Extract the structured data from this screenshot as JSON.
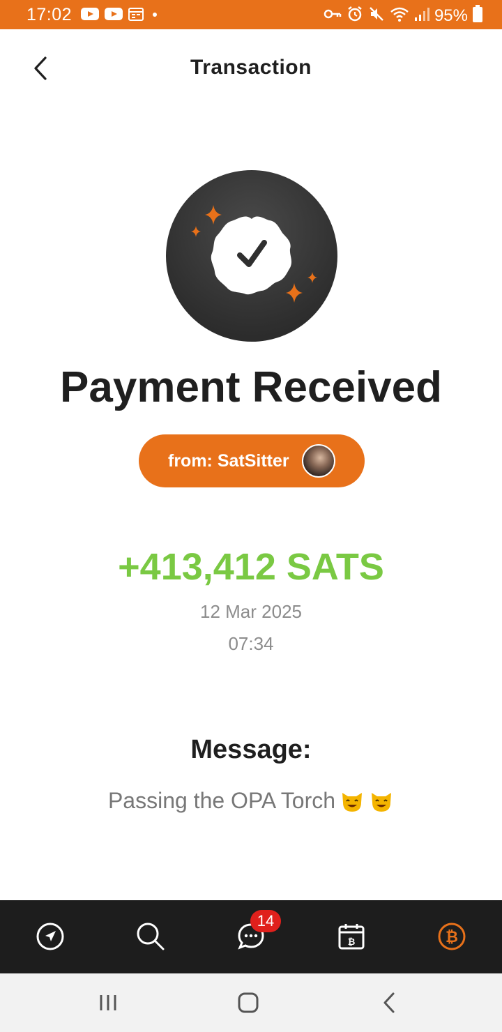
{
  "status_bar": {
    "time": "17:02",
    "battery": "95%",
    "left_icons": [
      "youtube-icon",
      "youtube-icon",
      "calendar-icon",
      "dot-icon"
    ],
    "right_icons": [
      "key-icon",
      "alarm-icon",
      "mute-icon",
      "wifi-icon",
      "signal-icon",
      "battery-icon"
    ]
  },
  "header": {
    "title": "Transaction"
  },
  "transaction": {
    "title": "Payment Received",
    "from": "from: SatSitter",
    "amount": "+413,412 SATS",
    "date": "12 Mar 2025",
    "time": "07:34",
    "message_label": "Message:",
    "message_text": "Passing the OPA Torch"
  },
  "bottom_nav": {
    "items": [
      "explore-icon",
      "search-icon",
      "chat-icon",
      "calendar-bitcoin-icon",
      "bitcoin-icon"
    ],
    "chat_badge": "14",
    "active": "bitcoin-icon"
  },
  "colors": {
    "accent": "#e8711a",
    "amount_green": "#7ac943",
    "nav_bg": "#1d1d1d",
    "badge_red": "#e0201c"
  }
}
